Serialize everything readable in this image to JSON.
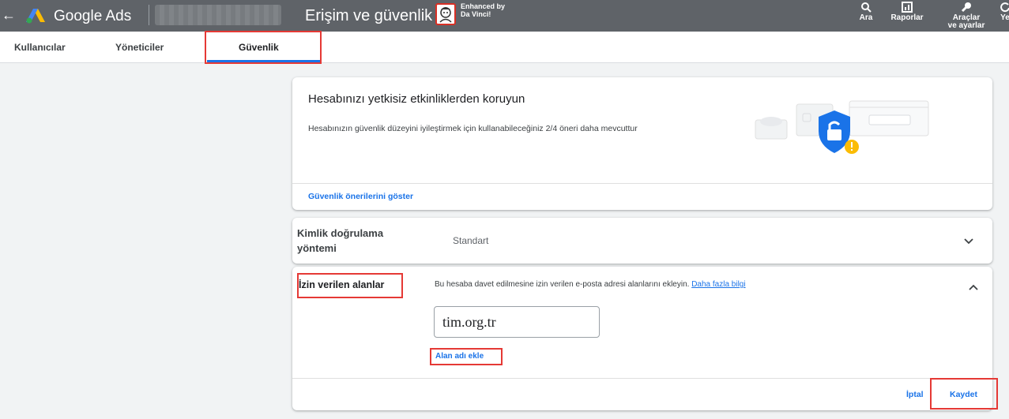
{
  "header": {
    "back_icon": "arrow-back-icon",
    "brand": "Google Ads",
    "page_title": "Erişim ve güvenlik",
    "extension_line1": "Enhanced by",
    "extension_line2": "Da Vinci!",
    "tools": [
      {
        "label": "Ara",
        "icon": "search-icon"
      },
      {
        "label": "Raporlar",
        "icon": "reports-icon"
      },
      {
        "label": "Araçlar",
        "label2": "ve ayarlar",
        "icon": "wrench-icon"
      },
      {
        "label": "Ye",
        "icon": "refresh-icon"
      }
    ]
  },
  "tabs": [
    {
      "label": "Kullanıcılar"
    },
    {
      "label": "Yöneticiler"
    },
    {
      "label": "Güvenlik",
      "active": true
    }
  ],
  "security_card": {
    "heading": "Hesabınızı yetkisiz etkinliklerden koruyun",
    "description": "Hesabınızın güvenlik düzeyini iyileştirmek için kullanabileceğiniz 2/4 öneri daha mevcuttur",
    "link": "Güvenlik önerilerini göster"
  },
  "auth_card": {
    "label": "Kimlik doğrulama yöntemi",
    "value": "Standart"
  },
  "domains_card": {
    "label": "İzin verilen alanlar",
    "info": "Bu hesaba davet edilmesine izin verilen e-posta adresi alanlarını ekleyin.",
    "info_link": "Daha fazla bilgi",
    "domain_value": "tim.org.tr",
    "add_link": "Alan adı ekle",
    "cancel": "İptal",
    "save": "Kaydet"
  },
  "colors": {
    "topbar": "#5f6368",
    "accent": "#1a73e8",
    "highlight_box": "#e53935",
    "background": "#f1f3f4"
  }
}
